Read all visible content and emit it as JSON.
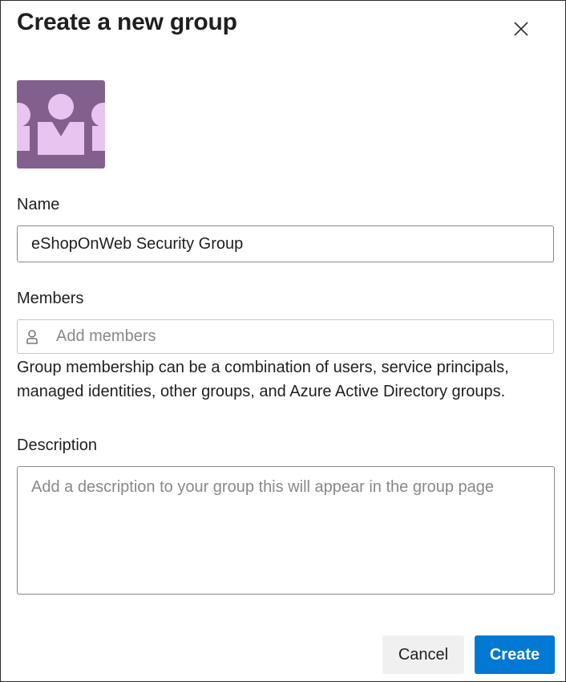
{
  "dialog": {
    "title": "Create a new group",
    "close_icon": "close-icon",
    "avatar_icon": "group-avatar-icon",
    "avatar_colors": {
      "background": "#82608e",
      "figures": "#e8c5f0"
    }
  },
  "form": {
    "name_label": "Name",
    "name_value": "eShopOnWeb Security Group",
    "members_label": "Members",
    "members_placeholder": "Add members",
    "members_icon": "person-icon",
    "members_help": "Group membership can be a combination of users, service principals, managed identities, other groups, and Azure Active Directory groups.",
    "description_label": "Description",
    "description_placeholder": "Add a description to your group this will appear in the group page"
  },
  "actions": {
    "cancel_label": "Cancel",
    "create_label": "Create"
  },
  "colors": {
    "primary": "#0078d4",
    "secondary_button": "#f0f0f0",
    "border": "#8a8886",
    "placeholder": "#8a8886"
  }
}
